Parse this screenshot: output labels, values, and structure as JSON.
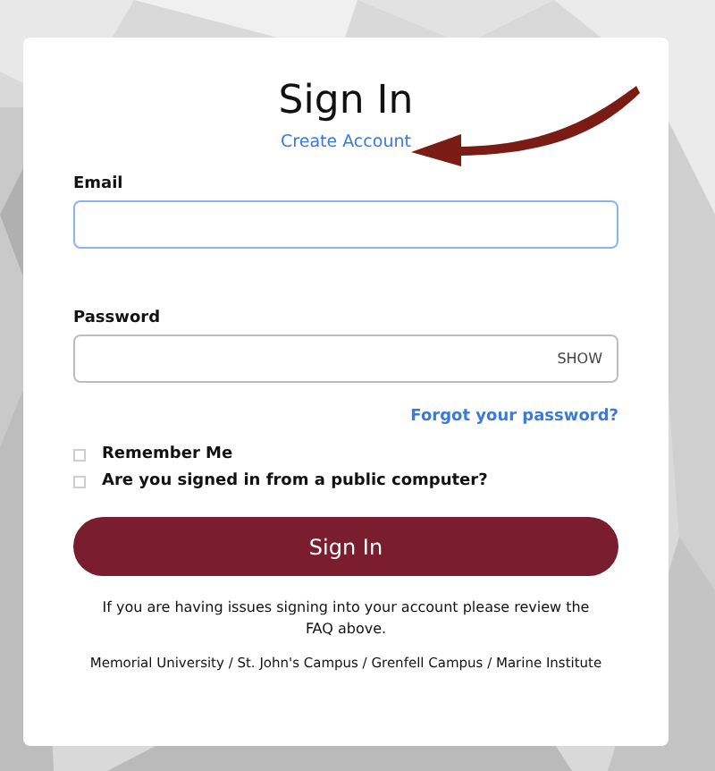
{
  "title": "Sign In",
  "create_account_link": "Create Account",
  "email": {
    "label": "Email",
    "focused": true
  },
  "password": {
    "label": "Password",
    "toggle": "SHOW",
    "focused": false
  },
  "forgot_link": "Forgot your password?",
  "options": [
    {
      "label": "Remember Me",
      "checked": false
    },
    {
      "label": "Are you signed in from a public computer?",
      "checked": false
    }
  ],
  "submit": "Sign In",
  "help_text": "If you are having issues signing into your account please review the FAQ above.",
  "footer": "Memorial University / St. John's Campus / Grenfell Campus / Marine Institute"
}
